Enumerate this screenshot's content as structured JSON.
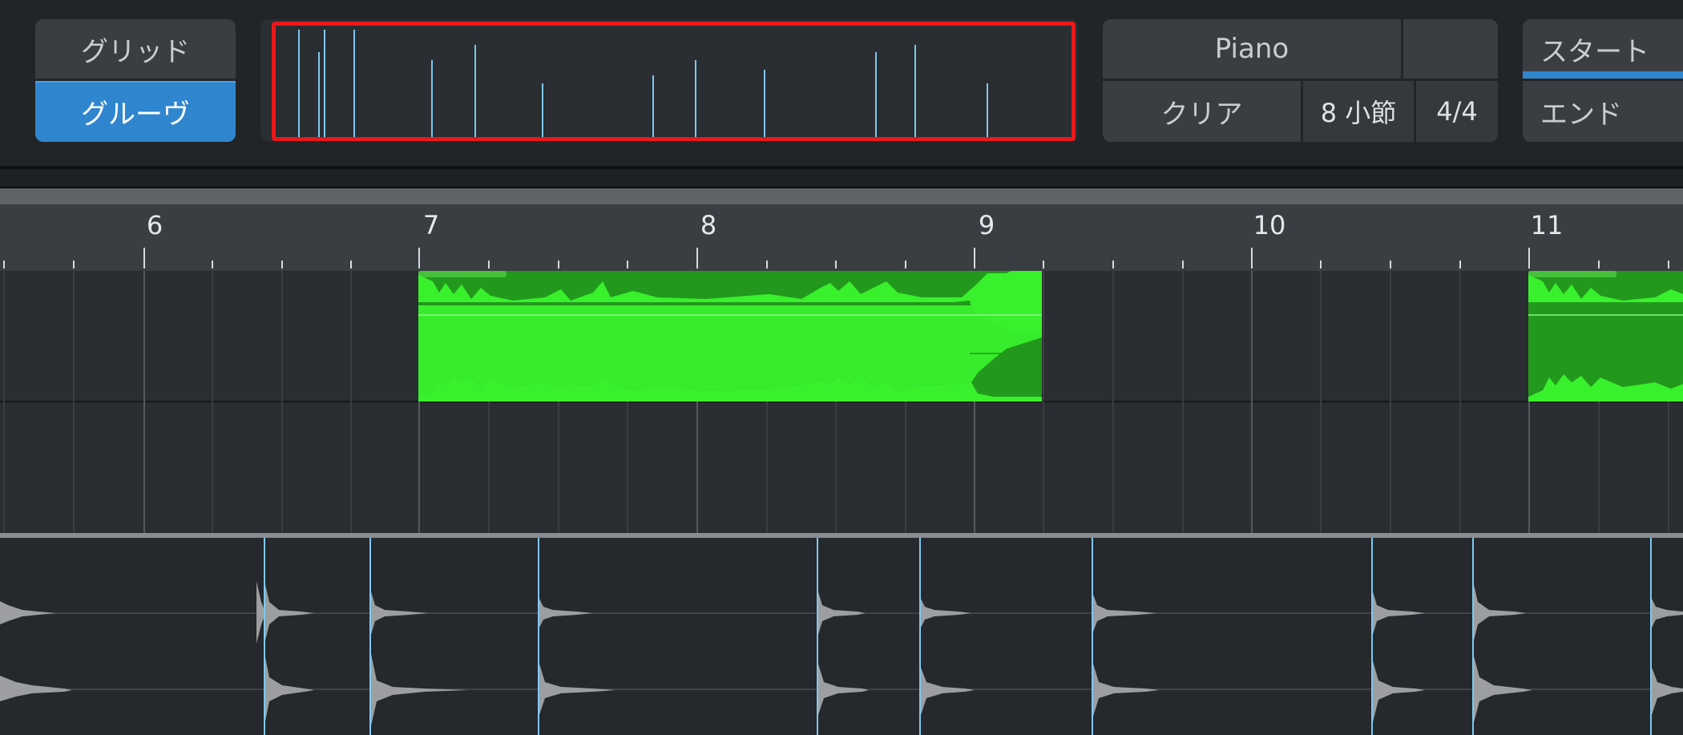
{
  "toolbar": {
    "grid_label": "グリッド",
    "groove_label": "グルーヴ",
    "instrument_label": "Piano",
    "clear_label": "クリア",
    "length_label": "8 小節",
    "meter_label": "4/4",
    "start_label": "スタート",
    "end_label": "エンド"
  },
  "ruler": {
    "bars": [
      {
        "label": "6"
      },
      {
        "label": "7"
      },
      {
        "label": "8"
      },
      {
        "label": "9"
      },
      {
        "label": "10"
      },
      {
        "label": "11"
      }
    ]
  },
  "colors": {
    "accent": "#2f86cf",
    "highlight": "#e8191c",
    "clip_fill": "#22991c",
    "clip_wave": "#39f02d",
    "hit_marker": "#7fc8ee",
    "audio_wave": "#9c9ea1"
  },
  "icons": []
}
